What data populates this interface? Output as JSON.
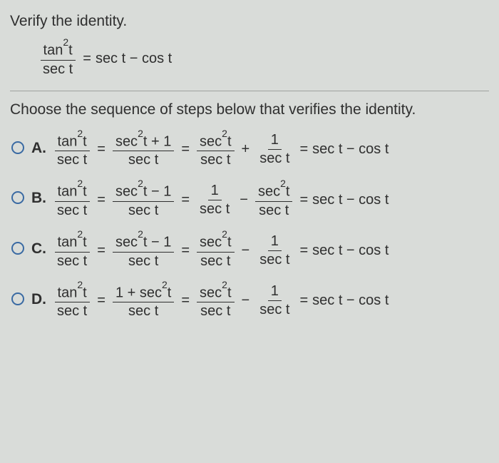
{
  "prompt": "Verify the identity.",
  "identity": {
    "lhs_num": "tan²t",
    "lhs_den": "sec t",
    "eq": "=",
    "rhs": "sec t − cos t"
  },
  "sub_prompt": "Choose the sequence of steps below that verifies the identity.",
  "options": [
    {
      "label": "A.",
      "steps": {
        "f1_num": "tan²t",
        "f1_den": "sec t",
        "eq1": "=",
        "f2_num": "sec²t + 1",
        "f2_den": "sec t",
        "eq2": "=",
        "f3_num": "sec²t",
        "f3_den": "sec t",
        "op": "+",
        "f4_num": "1",
        "f4_den": "sec t",
        "eq3": "=",
        "rhs": "sec t − cos t"
      }
    },
    {
      "label": "B.",
      "steps": {
        "f1_num": "tan²t",
        "f1_den": "sec t",
        "eq1": "=",
        "f2_num": "sec²t − 1",
        "f2_den": "sec t",
        "eq2": "=",
        "f3_num": "1",
        "f3_den": "sec t",
        "op": "−",
        "f4_num": "sec²t",
        "f4_den": "sec t",
        "eq3": "=",
        "rhs": "sec t − cos t"
      }
    },
    {
      "label": "C.",
      "steps": {
        "f1_num": "tan²t",
        "f1_den": "sec t",
        "eq1": "=",
        "f2_num": "sec²t − 1",
        "f2_den": "sec t",
        "eq2": "=",
        "f3_num": "sec²t",
        "f3_den": "sec t",
        "op": "−",
        "f4_num": "1",
        "f4_den": "sec t",
        "eq3": "=",
        "rhs": "sec t − cos t"
      }
    },
    {
      "label": "D.",
      "steps": {
        "f1_num": "tan²t",
        "f1_den": "sec t",
        "eq1": "=",
        "f2_num": "1 + sec²t",
        "f2_den": "sec t",
        "eq2": "=",
        "f3_num": "sec²t",
        "f3_den": "sec t",
        "op": "−",
        "f4_num": "1",
        "f4_den": "sec t",
        "eq3": "=",
        "rhs": "sec t − cos t"
      }
    }
  ]
}
